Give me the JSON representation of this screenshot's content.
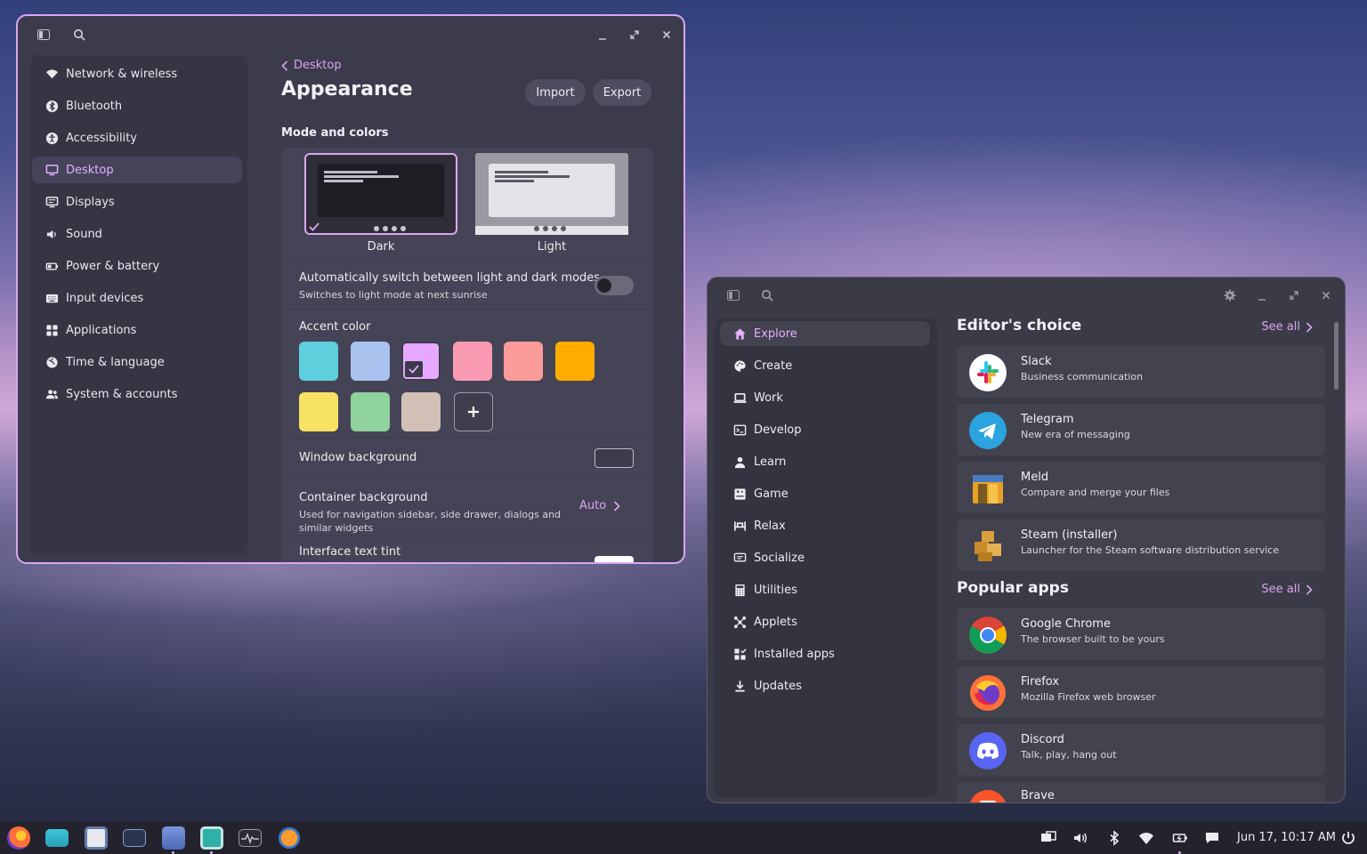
{
  "settings": {
    "nav": [
      {
        "label": "Network & wireless",
        "icon": "wifi-icon"
      },
      {
        "label": "Bluetooth",
        "icon": "bluetooth-icon"
      },
      {
        "label": "Accessibility",
        "icon": "accessibility-icon"
      },
      {
        "label": "Desktop",
        "icon": "monitor-icon",
        "active": true
      },
      {
        "label": "Displays",
        "icon": "displays-icon"
      },
      {
        "label": "Sound",
        "icon": "speaker-icon"
      },
      {
        "label": "Power & battery",
        "icon": "battery-icon"
      },
      {
        "label": "Input devices",
        "icon": "keyboard-icon"
      },
      {
        "label": "Applications",
        "icon": "grid-icon"
      },
      {
        "label": "Time & language",
        "icon": "globe-icon"
      },
      {
        "label": "System & accounts",
        "icon": "users-icon"
      }
    ],
    "back_label": "Desktop",
    "title": "Appearance",
    "import_label": "Import",
    "export_label": "Export",
    "section_mode": "Mode and colors",
    "mode_dark": "Dark",
    "mode_light": "Light",
    "auto_switch_title": "Automatically switch between light and dark modes",
    "auto_switch_sub": "Switches to light mode at next sunrise",
    "auto_switch_on": false,
    "accent_title": "Accent color",
    "accent_colors": [
      "#5ecfdc",
      "#a9c3ee",
      "#e6a8ff",
      "#fb9bb3",
      "#fb9b98",
      "#ffab00",
      "#f8e264",
      "#90d29b",
      "#d2c0b6"
    ],
    "accent_selected_index": 2,
    "window_bg_title": "Window background",
    "container_bg_title": "Container background",
    "container_bg_sub_1": "Used for navigation sidebar, side drawer, dialogs and",
    "container_bg_sub_2": "similar widgets",
    "container_bg_value": "Auto",
    "interface_tint_title": "Interface text tint"
  },
  "store": {
    "nav": [
      {
        "label": "Explore",
        "icon": "home-icon",
        "active": true
      },
      {
        "label": "Create",
        "icon": "palette-icon"
      },
      {
        "label": "Work",
        "icon": "laptop-icon"
      },
      {
        "label": "Develop",
        "icon": "terminal-icon"
      },
      {
        "label": "Learn",
        "icon": "student-icon"
      },
      {
        "label": "Game",
        "icon": "gamepad-icon"
      },
      {
        "label": "Relax",
        "icon": "sofa-icon"
      },
      {
        "label": "Socialize",
        "icon": "chat-icon"
      },
      {
        "label": "Utilities",
        "icon": "calculator-icon"
      },
      {
        "label": "Applets",
        "icon": "applets-icon"
      },
      {
        "label": "Installed apps",
        "icon": "installed-icon"
      },
      {
        "label": "Updates",
        "icon": "download-icon"
      }
    ],
    "editors_choice_title": "Editor's choice",
    "popular_title": "Popular apps",
    "see_all": "See all",
    "editors_choice": [
      {
        "name": "Slack",
        "desc": "Business communication",
        "icon": "slack-icon"
      },
      {
        "name": "Telegram",
        "desc": "New era of messaging",
        "icon": "telegram-icon"
      },
      {
        "name": "Meld",
        "desc": "Compare and merge your files",
        "icon": "meld-icon"
      },
      {
        "name": "Steam (installer)",
        "desc": "Launcher for the Steam software distribution service",
        "icon": "steam-installer-icon"
      }
    ],
    "popular": [
      {
        "name": "Google Chrome",
        "desc": "The browser built to be yours",
        "icon": "chrome-icon"
      },
      {
        "name": "Firefox",
        "desc": "Mozilla Firefox web browser",
        "icon": "firefox-icon"
      },
      {
        "name": "Discord",
        "desc": "Talk, play, hang out",
        "icon": "discord-icon"
      },
      {
        "name": "Brave",
        "desc": "",
        "icon": "brave-icon"
      }
    ]
  },
  "taskbar": {
    "clock": "Jun 17, 10:17 AM"
  },
  "colors": {
    "accent": "#d9a6f0",
    "window_bg": "#3c3b4c"
  }
}
